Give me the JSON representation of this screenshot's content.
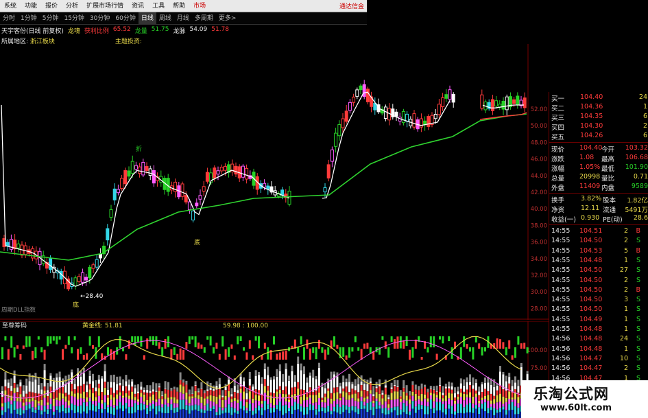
{
  "menu": {
    "items": [
      "系统",
      "功能",
      "报价",
      "分析",
      "扩展市场行情",
      "资讯",
      "工具",
      "帮助",
      "市场"
    ],
    "brand": "通达信金"
  },
  "periods": [
    "分时",
    "1分钟",
    "5分钟",
    "15分钟",
    "30分钟",
    "60分钟",
    "日线",
    "周线",
    "月线",
    "多周期",
    "更多>"
  ],
  "active_period": "日线",
  "header": {
    "left_label": "天宇客份(日线 前复权)",
    "logo": "龙魂",
    "ind1_label": "获利比例",
    "ind1_val": "65.52",
    "ind2_label": "龙量",
    "ind2_val": "51.75",
    "ind3_label": "龙脉",
    "ind3_val": "54.09",
    "ind4_val": "51.78",
    "region_label": "所属地区:",
    "region_val": "浙江板块",
    "theme_label": "主题投资:"
  },
  "main_chart": {
    "annotations": [
      {
        "text": "底"
      },
      {
        "text": "底"
      },
      {
        "text": "←28.40"
      },
      {
        "text": "折"
      }
    ],
    "bottom_label": "周期DLL指数",
    "y_ticks": [
      "52.00",
      "50.00",
      "48.00",
      "46.00",
      "44.00",
      "42.00",
      "40.00",
      "38.00",
      "36.00",
      "34.00",
      "32.00",
      "30.00",
      "28.00",
      "26.00"
    ]
  },
  "indicator": {
    "title": "至尊筹码",
    "label1": "黄金线: 51.81",
    "label2": "59.98 : 100.00",
    "y_ticks": [
      "100.00",
      "75.00",
      "50.00"
    ]
  },
  "quote": {
    "bids": [
      {
        "label": "买一",
        "price": "104.40",
        "vol": "24"
      },
      {
        "label": "买二",
        "price": "104.36",
        "vol": "1"
      },
      {
        "label": "买三",
        "price": "104.35",
        "vol": "6"
      },
      {
        "label": "买四",
        "price": "104.30",
        "vol": "2"
      },
      {
        "label": "买五",
        "price": "104.26",
        "vol": "6"
      }
    ],
    "stats": [
      {
        "k1": "现价",
        "v1": "104.40",
        "k2": "今开",
        "v2": "103.32"
      },
      {
        "k1": "涨跌",
        "v1": "1.08",
        "k2": "最高",
        "v2": "106.68"
      },
      {
        "k1": "涨幅",
        "v1": "1.05%",
        "k2": "最低",
        "v2": "101.90"
      },
      {
        "k1": "总量",
        "v1": "20998",
        "k2": "量比",
        "v2": "0.71"
      },
      {
        "k1": "外盘",
        "v1": "11409",
        "k2": "内盘",
        "v2": "9589"
      }
    ],
    "stats2": [
      {
        "k1": "换手",
        "v1": "3.82%",
        "k2": "股本",
        "v2": "1.82亿"
      },
      {
        "k1": "净资",
        "v1": "12.11",
        "k2": "流通",
        "v2": "5491万"
      },
      {
        "k1": "收益(一)",
        "v1": "0.930",
        "k2": "PE(动)",
        "v2": "28.6"
      }
    ],
    "ticks": [
      {
        "t": "14:55",
        "p": "104.51",
        "v": "2",
        "s": "B"
      },
      {
        "t": "14:55",
        "p": "104.50",
        "v": "2",
        "s": "S"
      },
      {
        "t": "14:55",
        "p": "104.53",
        "v": "5",
        "s": "B"
      },
      {
        "t": "14:55",
        "p": "104.48",
        "v": "1",
        "s": "S"
      },
      {
        "t": "14:55",
        "p": "104.50",
        "v": "27",
        "s": "S"
      },
      {
        "t": "14:55",
        "p": "104.50",
        "v": "2",
        "s": "S"
      },
      {
        "t": "14:55",
        "p": "104.50",
        "v": "2",
        "s": "B"
      },
      {
        "t": "14:55",
        "p": "104.50",
        "v": "3",
        "s": "S"
      },
      {
        "t": "14:55",
        "p": "104.50",
        "v": "1",
        "s": "S"
      },
      {
        "t": "14:55",
        "p": "104.49",
        "v": "1",
        "s": "S"
      },
      {
        "t": "14:55",
        "p": "104.48",
        "v": "1",
        "s": "S"
      },
      {
        "t": "14:56",
        "p": "104.48",
        "v": "24",
        "s": "S"
      },
      {
        "t": "14:56",
        "p": "104.48",
        "v": "1",
        "s": "S"
      },
      {
        "t": "14:56",
        "p": "104.47",
        "v": "10",
        "s": "S"
      },
      {
        "t": "14:56",
        "p": "104.47",
        "v": "2",
        "s": "S"
      },
      {
        "t": "14:56",
        "p": "104.47",
        "v": "1",
        "s": "S"
      }
    ]
  },
  "watermark": {
    "line1": "乐淘公式网",
    "line2": "www.60lt.com"
  },
  "colors": {
    "up": "#ff3b3b",
    "down": "#27d127",
    "ma_white": "#ffffff",
    "ma_green": "#2fd22f",
    "magenta": "#ff5cff",
    "cyan": "#33d6e6"
  }
}
